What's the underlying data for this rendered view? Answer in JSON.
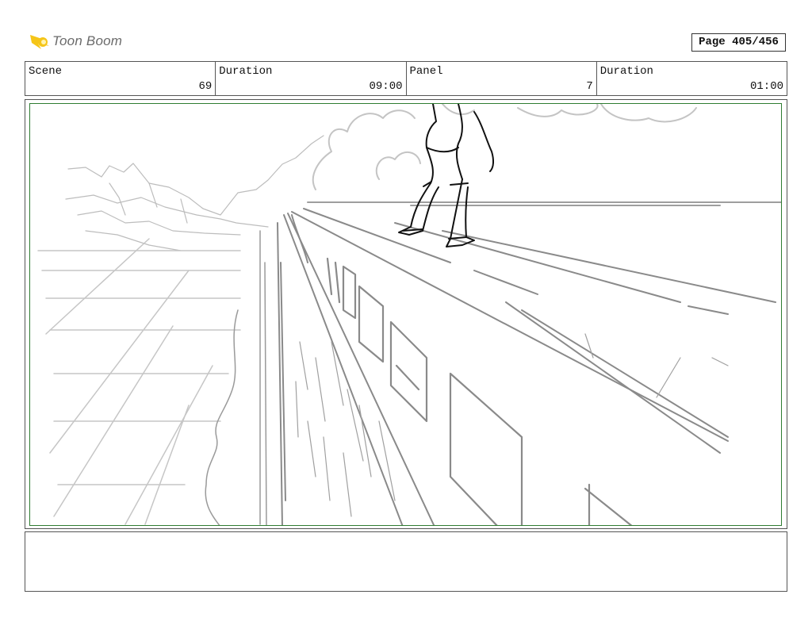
{
  "header": {
    "logo_text": "Toon Boom",
    "page_label": "Page 405/456"
  },
  "info": {
    "scene_label": "Scene",
    "scene_value": "69",
    "duration_label": "Duration",
    "duration_value": "09:00",
    "panel_label": "Panel",
    "panel_value": "7",
    "panel_duration_label": "Duration",
    "panel_duration_value": "01:00"
  },
  "notes": {
    "text": ""
  },
  "colors": {
    "frame_border": "#2f7d32",
    "logo_accent": "#f5c518",
    "sketch_dark": "#222222",
    "sketch_mid": "#8a8a8a",
    "sketch_light": "#bdbdbd"
  }
}
